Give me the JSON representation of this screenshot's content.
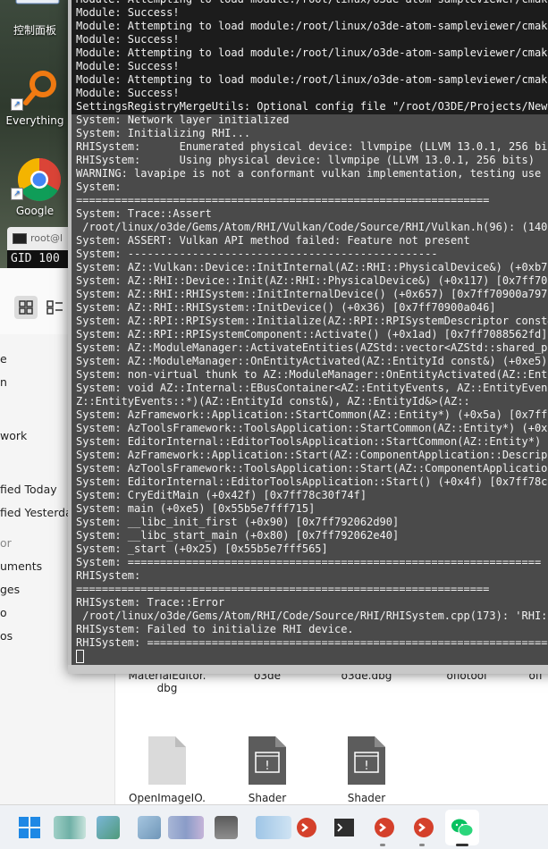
{
  "desktop": {
    "icons": [
      {
        "name": "control-panel",
        "label": "控制面板"
      },
      {
        "name": "everything",
        "label": "Everything"
      },
      {
        "name": "google-chrome",
        "label": "Google Chrome"
      }
    ]
  },
  "mini_terminal": {
    "tab_title": "root@l",
    "output": "GID 100"
  },
  "file_manager": {
    "sidebar": {
      "items": [
        {
          "label": "e",
          "top": 0
        },
        {
          "label": "n",
          "top": 0
        },
        {
          "label": "work",
          "top": 0
        },
        {
          "label": "fied Today",
          "top": 0
        },
        {
          "label": "fied Yesterda",
          "top": 0
        },
        {
          "label": "or",
          "top": 0
        },
        {
          "label": "uments",
          "top": 0
        },
        {
          "label": "ges",
          "top": 0
        },
        {
          "label": "o",
          "top": 0
        },
        {
          "label": "os",
          "top": 0
        }
      ]
    },
    "files": [
      {
        "label": "MaterialEditor.dbg",
        "line1": "MaterialEditor.",
        "line2": "dbg"
      },
      {
        "label": "o3de",
        "line1": "o3de",
        "line2": ""
      },
      {
        "label": "o3de.dbg",
        "line1": "o3de.dbg",
        "line2": ""
      },
      {
        "label": "oflotool",
        "line1": "oflotool",
        "line2": ""
      },
      {
        "label": "ofl",
        "line1": "ofl",
        "line2": ""
      },
      {
        "label": "OpenImageIO.",
        "line1": "OpenImageIO.",
        "line2": ""
      },
      {
        "label": "Shader",
        "line1": "Shader",
        "line2": ""
      },
      {
        "label": "Shader",
        "line1": "Shader",
        "line2": ""
      }
    ]
  },
  "terminal": {
    "lines": [
      "Module: Attempting to load module:/root/linux/o3de-atom-sampleviewer/cmake-b",
      "Module: Success!",
      "Module: Attempting to load module:/root/linux/o3de-atom-sampleviewer/cmake-b",
      "Module: Success!",
      "Module: Attempting to load module:/root/linux/o3de-atom-sampleviewer/cmake-b",
      "Module: Success!",
      "Module: Attempting to load module:/root/linux/o3de-atom-sampleviewer/cmake-b",
      "Module: Success!",
      "SettingsRegistryMergeUtils: Optional config file \"/root/O3DE/Projects/NewPro",
      "System: Network layer initialized",
      "System: Initializing RHI...",
      "RHISystem:      Enumerated physical device: llvmpipe (LLVM 13.0.1, 256 bits)",
      "RHISystem:      Using physical device: llvmpipe (LLVM 13.0.1, 256 bits)",
      "WARNING: lavapipe is not a conformant vulkan implementation, testing use onl",
      "System:",
      "================================================================",
      "System: Trace::Assert",
      " /root/linux/o3de/Gems/Atom/RHI/Vulkan/Code/Source/RHI/Vulkan.h(96): (140701",
      "System: ASSERT: Vulkan API method failed: Feature not present",
      "System: ------------------------------------------------",
      "System: AZ::Vulkan::Device::InitInternal(AZ::RHI::PhysicalDevice&) (+0xb7a) ",
      "System: AZ::RHI::Device::Init(AZ::RHI::PhysicalDevice&) (+0x117) [0x7ff70907",
      "System: AZ::RHI::RHISystem::InitInternalDevice() (+0x657) [0x7ff70900a797]",
      "System: AZ::RHI::RHISystem::InitDevice() (+0x36) [0x7ff70900a046]",
      "System: AZ::RPI::RPISystem::Initialize(AZ::RPI::RPISystemDescriptor const&) ",
      "System: AZ::RPI::RPISystemComponent::Activate() (+0x1ad) [0x7ff7088562fd]",
      "System: AZ::ModuleManager::ActivateEntities(AZStd::vector<AZStd::shared_ptr<",
      "System: AZ::ModuleManager::OnEntityActivated(AZ::EntityId const&) (+0xe5) [0",
      "System: non-virtual thunk to AZ::ModuleManager::OnEntityActivated(AZ::Entity",
      "System: void AZ::Internal::EBusContainer<AZ::EntityEvents, AZ::EntityEvents",
      "Z::EntityEvents::*)(AZ::EntityId const&), AZ::EntityId&>(AZ::",
      "System: AzFramework::Application::StartCommon(AZ::Entity*) (+0x5a) [0x7ff78",
      "System: AzToolsFramework::ToolsApplication::StartCommon(AZ::Entity*) (+0x19",
      "System: EditorInternal::EditorToolsApplication::StartCommon(AZ::Entity*) (+0",
      "System: AzFramework::Application::Start(AZ::ComponentApplication::Descripto",
      "System: AzToolsFramework::ToolsApplication::Start(AZ::ComponentApplication:",
      "System: EditorInternal::EditorToolsApplication::Start() (+0x4f) [0x7ff78c25",
      "System: CryEditMain (+0x42f) [0x7ff78c30f74f]",
      "System: main (+0xe5) [0x55b5e7fff715]",
      "System: __libc_init_first (+0x90) [0x7ff792062d90]",
      "System: __libc_start_main (+0x80) [0x7ff792062e40]",
      "System: _start (+0x25) [0x55b5e7fff565]",
      "System: ================================================================",
      "RHISystem:",
      "================================================================",
      "RHISystem: Trace::Error",
      " /root/linux/o3de/Gems/Atom/RHI/Code/Source/RHI/RHISystem.cpp(173): 'RHI::P",
      "RHISystem: Failed to initialize RHI device.",
      "RHISystem: ================================================================"
    ]
  },
  "taskbar": {
    "apps": [
      {
        "name": "start-menu"
      },
      {
        "name": "app-1"
      },
      {
        "name": "app-2"
      },
      {
        "name": "app-3"
      },
      {
        "name": "app-4"
      },
      {
        "name": "app-5"
      },
      {
        "name": "app-6"
      },
      {
        "name": "remote-desktop-1"
      },
      {
        "name": "terminal"
      },
      {
        "name": "remote-desktop-2"
      },
      {
        "name": "remote-desktop-3"
      },
      {
        "name": "wechat"
      }
    ]
  }
}
